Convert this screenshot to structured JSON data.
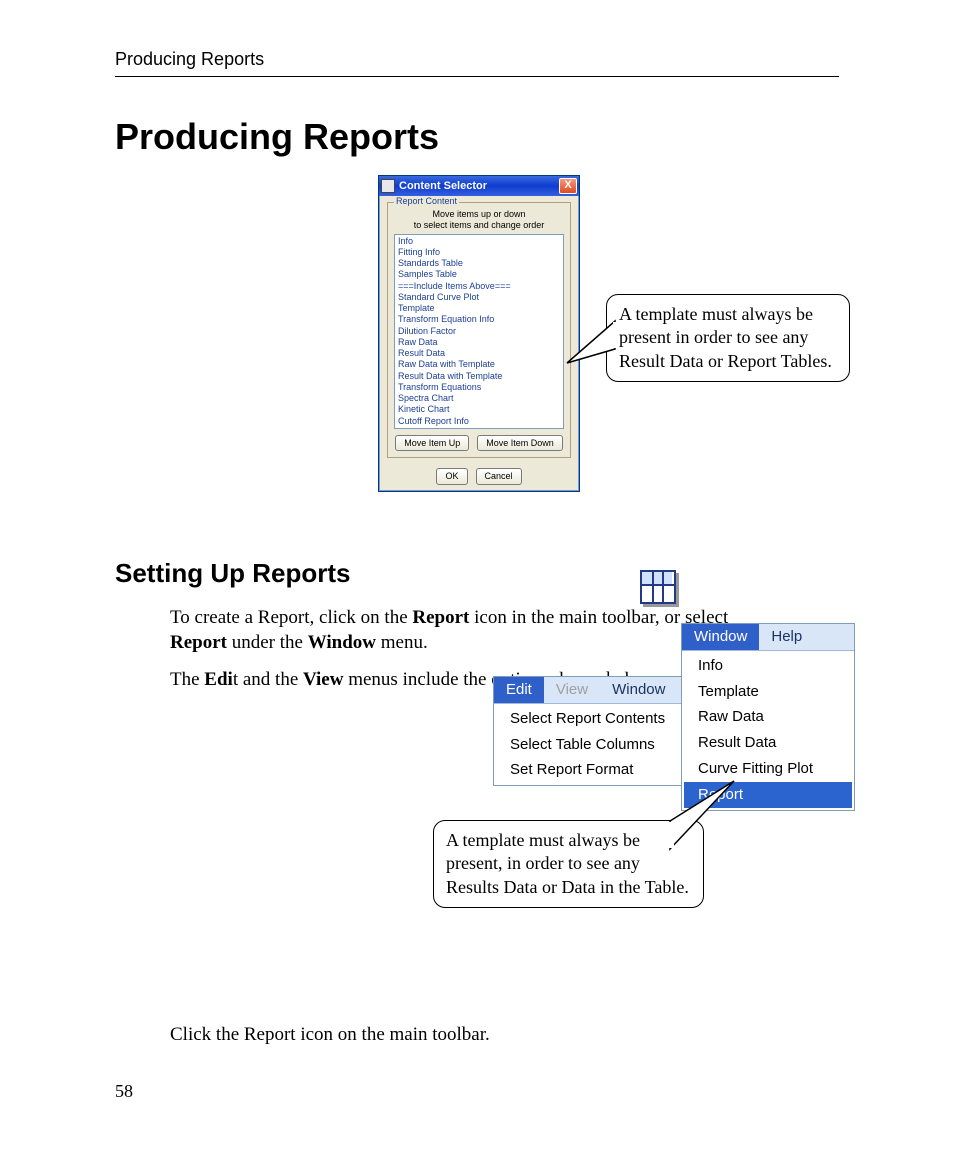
{
  "header": {
    "running": "Producing Reports"
  },
  "h1": "Producing Reports",
  "dialog": {
    "title": "Content Selector",
    "group_legend": "Report Content",
    "instr1": "Move items up or down",
    "instr2": "to select items and change order",
    "items": [
      "Info",
      "Fitting Info",
      "Standards Table",
      "Samples Table",
      "===Include Items Above===",
      "Standard Curve Plot",
      "Template",
      "Transform Equation Info",
      "Dilution Factor",
      "Raw Data",
      "Result Data",
      "Raw Data with Template",
      "Result Data with Template",
      "Transform Equations",
      "Spectra Chart",
      "Kinetic Chart",
      "Cutoff Report Info"
    ],
    "btn_up": "Move Item Up",
    "btn_down": "Move Item Down",
    "btn_ok": "OK",
    "btn_cancel": "Cancel",
    "close_glyph": "X"
  },
  "callout1": "A template must always be present in order to see any Result Data or Report Tables.",
  "h2": "Setting Up Reports",
  "para1_a": "To create a Report, click on the ",
  "para1_b": "Report",
  "para1_c": " icon in the main toolbar, or select ",
  "para1_d": "Report",
  "para1_e": " under the ",
  "para1_f": "Window",
  "para1_g": " menu.",
  "para2_a": "The ",
  "para2_b": "Edi",
  "para2_c": "t and the ",
  "para2_d": "View",
  "para2_e": " menus include the options shown below:",
  "menuA": {
    "bar": [
      "Edit",
      "View",
      "Window",
      "Help"
    ],
    "bar_active_index": 0,
    "bar_dim_index": 1,
    "items": [
      "Select Report Contents",
      "Select Table Columns",
      "Set Report Format"
    ]
  },
  "menuB": {
    "bar": [
      "Window",
      "Help"
    ],
    "bar_active_index": 0,
    "items": [
      "Info",
      "Template",
      "Raw Data",
      "Result Data",
      "Curve Fitting Plot",
      "Report"
    ],
    "selected_index": 5
  },
  "callout2": "A template must always be present, in order to see any Results Data or Data in the Table.",
  "para3": "Click the Report icon on the main toolbar.",
  "pagenum": "58"
}
